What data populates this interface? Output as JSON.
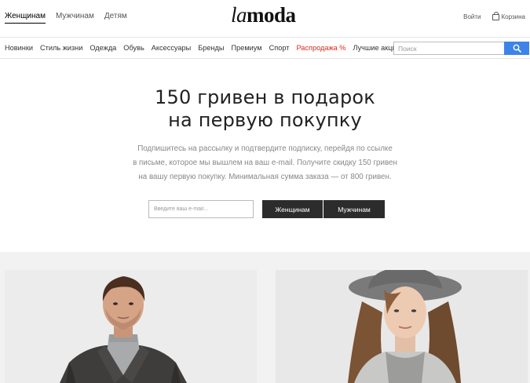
{
  "header": {
    "gender_tabs": [
      {
        "label": "Женщинам",
        "active": true
      },
      {
        "label": "Мужчинам",
        "active": false
      },
      {
        "label": "Детям",
        "active": false
      }
    ],
    "logo": {
      "part1": "la",
      "part2": "moda"
    },
    "login_label": "Войти",
    "cart_label": "Корзина",
    "cart_icon": "shopping-bag-icon"
  },
  "nav": {
    "items": [
      {
        "label": "Новинки"
      },
      {
        "label": "Стиль жизни"
      },
      {
        "label": "Одежда"
      },
      {
        "label": "Обувь"
      },
      {
        "label": "Аксессуары"
      },
      {
        "label": "Бренды"
      },
      {
        "label": "Премиум"
      },
      {
        "label": "Спорт"
      },
      {
        "label": "Распродажа %",
        "highlight": true
      },
      {
        "label": "Лучшие акции"
      }
    ],
    "search_placeholder": "Поиск",
    "search_icon": "search-icon"
  },
  "promo": {
    "headline_line1": "150 гривен в подарок",
    "headline_line2": "на первую покупку",
    "subtext_line1": "Подпишитесь на рассылку и подтвердите подписку, перейдя по ссылке",
    "subtext_line2": "в письме, которое мы вышлем на ваш e-mail. Получите скидку 150 гривен",
    "subtext_line3": "на вашу первую покупку. Минимальная сумма заказа — от 800 гривен.",
    "email_placeholder": "Введите ваш e-mail...",
    "women_button": "Женщинам",
    "men_button": "Мужчинам"
  },
  "colors": {
    "sale": "#e0281d",
    "search_button": "#3d84e8",
    "dark_button": "#2c2c2c",
    "gallery_bg": "#f2f2f2"
  }
}
